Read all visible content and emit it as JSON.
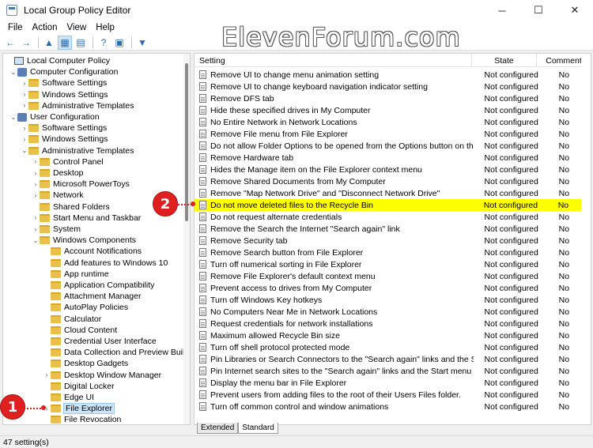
{
  "window": {
    "title": "Local Group Policy Editor",
    "minimize": "─",
    "maximize": "☐",
    "close": "✕"
  },
  "menu": [
    "File",
    "Action",
    "View",
    "Help"
  ],
  "toolbar": {
    "back": "←",
    "forward": "→",
    "up": "▲",
    "show_hide": "▦",
    "export": "▤",
    "help": "?",
    "properties": "▣",
    "filter": "▼"
  },
  "watermark": "ElevenForum.com",
  "tree": [
    {
      "label": "Local Computer Policy",
      "level": 0,
      "exp": "",
      "icon": "pc"
    },
    {
      "label": "Computer Configuration",
      "level": 1,
      "exp": "v",
      "icon": "cfg"
    },
    {
      "label": "Software Settings",
      "level": 2,
      "exp": ">",
      "icon": "folder"
    },
    {
      "label": "Windows Settings",
      "level": 2,
      "exp": ">",
      "icon": "folder"
    },
    {
      "label": "Administrative Templates",
      "level": 2,
      "exp": ">",
      "icon": "folder"
    },
    {
      "label": "User Configuration",
      "level": 1,
      "exp": "v",
      "icon": "cfg"
    },
    {
      "label": "Software Settings",
      "level": 2,
      "exp": ">",
      "icon": "folder"
    },
    {
      "label": "Windows Settings",
      "level": 2,
      "exp": ">",
      "icon": "folder"
    },
    {
      "label": "Administrative Templates",
      "level": 2,
      "exp": "v",
      "icon": "folder"
    },
    {
      "label": "Control Panel",
      "level": 3,
      "exp": ">",
      "icon": "folder"
    },
    {
      "label": "Desktop",
      "level": 3,
      "exp": ">",
      "icon": "folder"
    },
    {
      "label": "Microsoft PowerToys",
      "level": 3,
      "exp": ">",
      "icon": "folder"
    },
    {
      "label": "Network",
      "level": 3,
      "exp": ">",
      "icon": "folder"
    },
    {
      "label": "Shared Folders",
      "level": 3,
      "exp": "",
      "icon": "folder"
    },
    {
      "label": "Start Menu and Taskbar",
      "level": 3,
      "exp": ">",
      "icon": "folder"
    },
    {
      "label": "System",
      "level": 3,
      "exp": ">",
      "icon": "folder"
    },
    {
      "label": "Windows Components",
      "level": 3,
      "exp": "v",
      "icon": "folder"
    },
    {
      "label": "Account Notifications",
      "level": 4,
      "exp": "",
      "icon": "folder"
    },
    {
      "label": "Add features to Windows 10",
      "level": 4,
      "exp": "",
      "icon": "folder"
    },
    {
      "label": "App runtime",
      "level": 4,
      "exp": "",
      "icon": "folder"
    },
    {
      "label": "Application Compatibility",
      "level": 4,
      "exp": "",
      "icon": "folder"
    },
    {
      "label": "Attachment Manager",
      "level": 4,
      "exp": "",
      "icon": "folder"
    },
    {
      "label": "AutoPlay Policies",
      "level": 4,
      "exp": "",
      "icon": "folder"
    },
    {
      "label": "Calculator",
      "level": 4,
      "exp": "",
      "icon": "folder"
    },
    {
      "label": "Cloud Content",
      "level": 4,
      "exp": "",
      "icon": "folder"
    },
    {
      "label": "Credential User Interface",
      "level": 4,
      "exp": "",
      "icon": "folder"
    },
    {
      "label": "Data Collection and Preview Builds",
      "level": 4,
      "exp": "",
      "icon": "folder"
    },
    {
      "label": "Desktop Gadgets",
      "level": 4,
      "exp": "",
      "icon": "folder"
    },
    {
      "label": "Desktop Window Manager",
      "level": 4,
      "exp": ">",
      "icon": "folder"
    },
    {
      "label": "Digital Locker",
      "level": 4,
      "exp": "",
      "icon": "folder"
    },
    {
      "label": "Edge UI",
      "level": 4,
      "exp": "",
      "icon": "folder"
    },
    {
      "label": "File Explorer",
      "level": 4,
      "exp": ">",
      "icon": "folder",
      "selected": true
    },
    {
      "label": "File Revocation",
      "level": 4,
      "exp": "",
      "icon": "folder"
    }
  ],
  "list": {
    "headers": {
      "setting": "Setting",
      "state": "State",
      "comment": "Comment"
    },
    "rows": [
      {
        "setting": "Remove UI to change menu animation setting",
        "state": "Not configured",
        "comment": "No"
      },
      {
        "setting": "Remove UI to change keyboard navigation indicator setting",
        "state": "Not configured",
        "comment": "No"
      },
      {
        "setting": "Remove DFS tab",
        "state": "Not configured",
        "comment": "No"
      },
      {
        "setting": "Hide these specified drives in My Computer",
        "state": "Not configured",
        "comment": "No"
      },
      {
        "setting": "No Entire Network in Network Locations",
        "state": "Not configured",
        "comment": "No"
      },
      {
        "setting": "Remove File menu from File Explorer",
        "state": "Not configured",
        "comment": "No"
      },
      {
        "setting": "Do not allow Folder Options to be opened from the Options button on the Vie...",
        "state": "Not configured",
        "comment": "No"
      },
      {
        "setting": "Remove Hardware tab",
        "state": "Not configured",
        "comment": "No"
      },
      {
        "setting": "Hides the Manage item on the File Explorer context menu",
        "state": "Not configured",
        "comment": "No"
      },
      {
        "setting": "Remove Shared Documents from My Computer",
        "state": "Not configured",
        "comment": "No"
      },
      {
        "setting": "Remove \"Map Network Drive\" and \"Disconnect Network Drive\"",
        "state": "Not configured",
        "comment": "No"
      },
      {
        "setting": "Do not move deleted files to the Recycle Bin",
        "state": "Not configured",
        "comment": "No",
        "highlight": true
      },
      {
        "setting": "Do not request alternate credentials",
        "state": "Not configured",
        "comment": "No"
      },
      {
        "setting": "Remove the Search the Internet \"Search again\" link",
        "state": "Not configured",
        "comment": "No"
      },
      {
        "setting": "Remove Security tab",
        "state": "Not configured",
        "comment": "No"
      },
      {
        "setting": "Remove Search button from File Explorer",
        "state": "Not configured",
        "comment": "No"
      },
      {
        "setting": "Turn off numerical sorting in File Explorer",
        "state": "Not configured",
        "comment": "No"
      },
      {
        "setting": "Remove File Explorer's default context menu",
        "state": "Not configured",
        "comment": "No"
      },
      {
        "setting": "Prevent access to drives from My Computer",
        "state": "Not configured",
        "comment": "No"
      },
      {
        "setting": "Turn off Windows Key hotkeys",
        "state": "Not configured",
        "comment": "No"
      },
      {
        "setting": "No Computers Near Me in Network Locations",
        "state": "Not configured",
        "comment": "No"
      },
      {
        "setting": "Request credentials for network installations",
        "state": "Not configured",
        "comment": "No"
      },
      {
        "setting": "Maximum allowed Recycle Bin size",
        "state": "Not configured",
        "comment": "No"
      },
      {
        "setting": "Turn off shell protocol protected mode",
        "state": "Not configured",
        "comment": "No"
      },
      {
        "setting": "Pin Libraries or Search Connectors to the \"Search again\" links and the Start menu",
        "state": "Not configured",
        "comment": "No"
      },
      {
        "setting": "Pin Internet search sites to the \"Search again\" links and the Start menu",
        "state": "Not configured",
        "comment": "No"
      },
      {
        "setting": "Display the menu bar in File Explorer",
        "state": "Not configured",
        "comment": "No"
      },
      {
        "setting": "Prevent users from adding files to the root of their Users Files folder.",
        "state": "Not configured",
        "comment": "No"
      },
      {
        "setting": "Turn off common control and window animations",
        "state": "Not configured",
        "comment": "No"
      }
    ]
  },
  "tabs": [
    "Extended",
    "Standard"
  ],
  "status": "47 setting(s)",
  "callouts": {
    "one": "1",
    "two": "2"
  },
  "colors": {
    "highlight": "#ffff00",
    "callout": "#e02020",
    "selection": "#cce4f7"
  }
}
